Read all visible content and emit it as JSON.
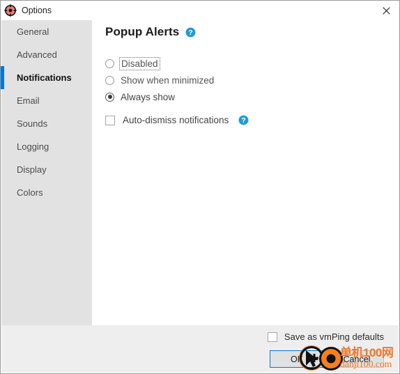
{
  "window": {
    "title": "Options",
    "icon": "target-crosshair-icon",
    "close_label": "✕"
  },
  "sidebar": {
    "items": [
      {
        "label": "General",
        "selected": false
      },
      {
        "label": "Advanced",
        "selected": false
      },
      {
        "label": "Notifications",
        "selected": true
      },
      {
        "label": "Email",
        "selected": false
      },
      {
        "label": "Sounds",
        "selected": false
      },
      {
        "label": "Logging",
        "selected": false
      },
      {
        "label": "Display",
        "selected": false
      },
      {
        "label": "Colors",
        "selected": false
      }
    ],
    "accent_color": "#0078d7",
    "background_color": "#e2e2e2"
  },
  "main": {
    "section_title": "Popup Alerts",
    "section_help_icon": "help-question-icon",
    "popup_alerts": {
      "options": [
        {
          "label": "Disabled",
          "checked": false,
          "focused": true
        },
        {
          "label": "Show when minimized",
          "checked": false,
          "focused": false
        },
        {
          "label": "Always show",
          "checked": true,
          "focused": false
        }
      ]
    },
    "auto_dismiss": {
      "label": "Auto-dismiss notifications",
      "checked": false,
      "help_icon": "help-question-icon"
    }
  },
  "footer": {
    "save_defaults": {
      "label": "Save as vmPing defaults",
      "checked": false
    },
    "ok_label": "OK",
    "cancel_label": "Cancel"
  },
  "overlay": {
    "cursor_icon": "mouse-click-cursor-icon",
    "watermark_cn": "单机100网",
    "watermark_en": "danji100.com",
    "watermark_color": "#f0782a"
  }
}
